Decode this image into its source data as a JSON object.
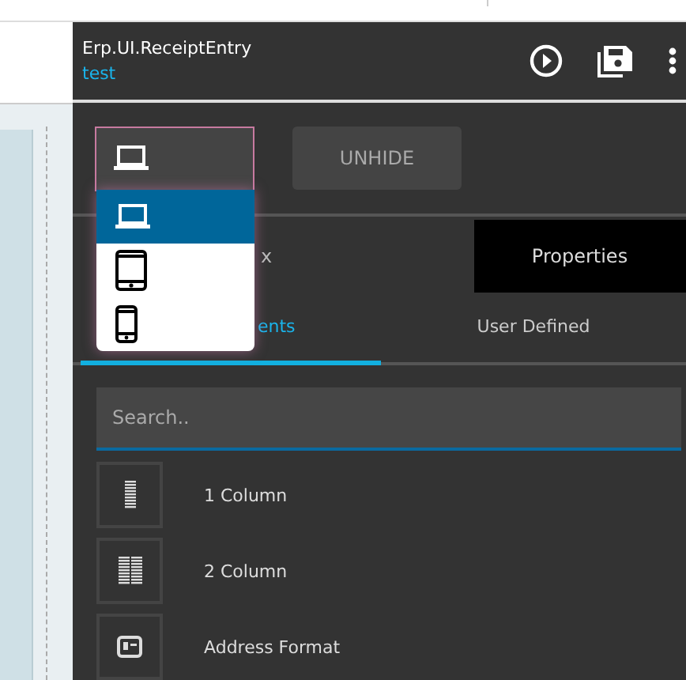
{
  "panel": {
    "title": "Erp.UI.ReceiptEntry",
    "subtitle": "test"
  },
  "device_select": {
    "expanded": true,
    "options": [
      {
        "kind": "laptop",
        "selected": true
      },
      {
        "kind": "tablet",
        "selected": false
      },
      {
        "kind": "phone",
        "selected": false
      }
    ]
  },
  "unhide_button": "UNHIDE",
  "tabs": [
    {
      "label": "x",
      "selected": false
    },
    {
      "label": "Properties",
      "selected": true
    }
  ],
  "subtabs": [
    {
      "label": "ents",
      "selected": true
    },
    {
      "label": "User Defined",
      "selected": false
    }
  ],
  "search": {
    "placeholder": "Search.."
  },
  "items": [
    {
      "kind": "one-column",
      "label": "1 Column"
    },
    {
      "kind": "two-column",
      "label": "2 Column"
    },
    {
      "kind": "address",
      "label": "Address Format"
    }
  ]
}
